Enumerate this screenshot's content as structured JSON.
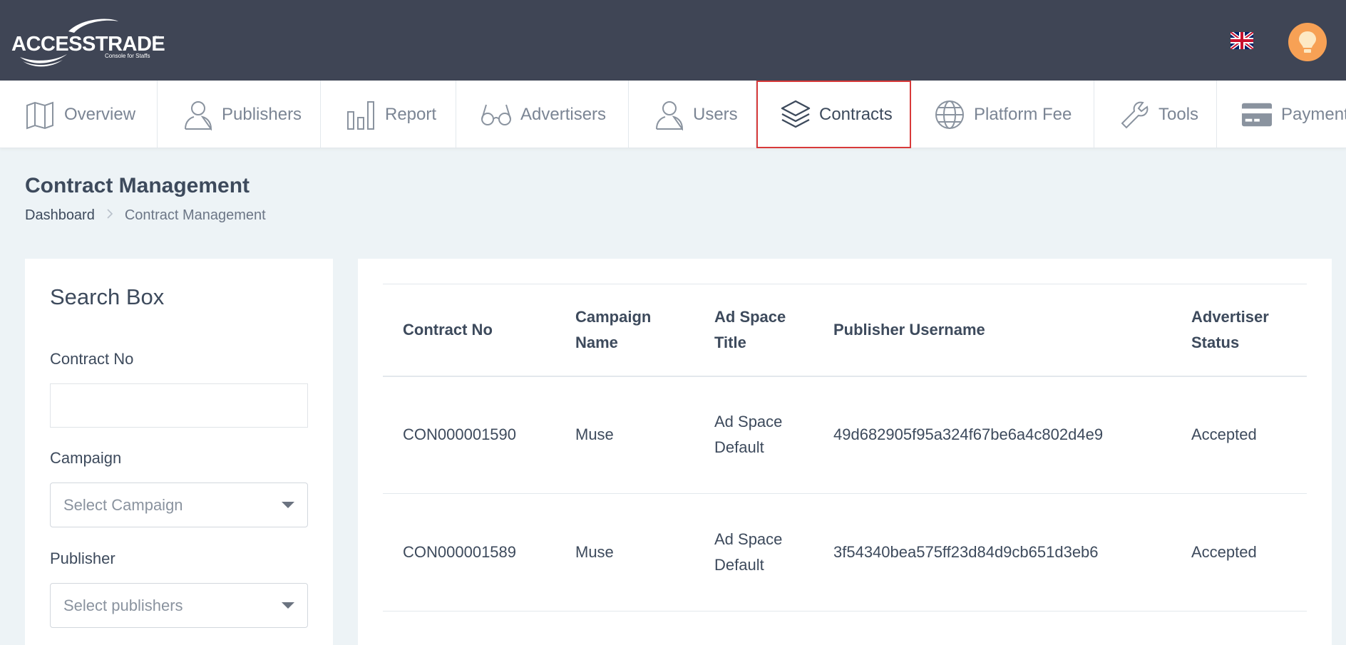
{
  "header": {
    "logo_text": "ACCESSTRADE",
    "logo_tm": "™",
    "logo_subtitle": "Console for Staffs",
    "flag_icon": "uk-flag-icon",
    "avatar_icon": "lightbulb-icon",
    "avatar_color": "#f7a155"
  },
  "nav": {
    "items": [
      {
        "label": "Overview",
        "icon": "map-icon"
      },
      {
        "label": "Publishers",
        "icon": "user-icon"
      },
      {
        "label": "Report",
        "icon": "bar-chart-icon"
      },
      {
        "label": "Advertisers",
        "icon": "glasses-icon"
      },
      {
        "label": "Users",
        "icon": "user-icon"
      },
      {
        "label": "Contracts",
        "icon": "layers-icon",
        "active": true
      },
      {
        "label": "Platform Fee",
        "icon": "globe-icon"
      },
      {
        "label": "Tools",
        "icon": "wrench-icon"
      },
      {
        "label": "Payment",
        "icon": "credit-card-icon"
      }
    ]
  },
  "page": {
    "title": "Contract Management",
    "breadcrumb": {
      "home": "Dashboard",
      "separator": ">",
      "current": "Contract Management"
    }
  },
  "search_box": {
    "title": "Search Box",
    "contract_no_label": "Contract No",
    "contract_no_value": "",
    "campaign_label": "Campaign",
    "campaign_placeholder": "Select Campaign",
    "publisher_label": "Publisher",
    "publisher_placeholder": "Select publishers"
  },
  "table": {
    "headers": [
      "Contract No",
      "Campaign Name",
      "Ad Space Title",
      "Publisher Username",
      "Advertiser Status"
    ],
    "rows": [
      [
        "CON000001590",
        "Muse",
        "Ad Space Default",
        "49d682905f95a324f67be6a4c802d4e9",
        "Accepted"
      ],
      [
        "CON000001589",
        "Muse",
        "Ad Space Default",
        "3f54340bea575ff23d84d9cb651d3eb6",
        "Accepted"
      ]
    ]
  },
  "colors": {
    "header_bg": "#3f4555",
    "active_border": "#d83a3a",
    "page_bg": "#edf3f6"
  }
}
